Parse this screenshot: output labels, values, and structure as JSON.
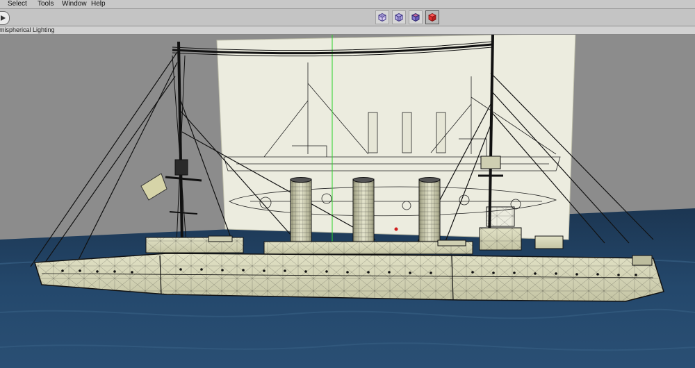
{
  "menubar": {
    "items": [
      "Select",
      "Tools",
      "Window",
      "Help"
    ]
  },
  "toolbar": {
    "nav_icon": "arrow-right-icon",
    "shading_buttons": [
      {
        "icon": "wireframe-cube-icon",
        "active": false
      },
      {
        "icon": "smooth-wire-cube-icon",
        "active": false
      },
      {
        "icon": "shaded-wire-cube-icon",
        "active": false
      },
      {
        "icon": "shaded-cube-icon",
        "active": true
      }
    ]
  },
  "panel": {
    "lighting_label": "mispherical Lighting"
  },
  "colors": {
    "menubar_bg": "#c8c8c8",
    "viewport_bg": "#8c8c8c",
    "water": "#1f3d5c",
    "hull": "#d8d8b8",
    "reference_plane": "#ececdf",
    "axis_line": "#2ad22a",
    "active_button": "#e03030"
  }
}
